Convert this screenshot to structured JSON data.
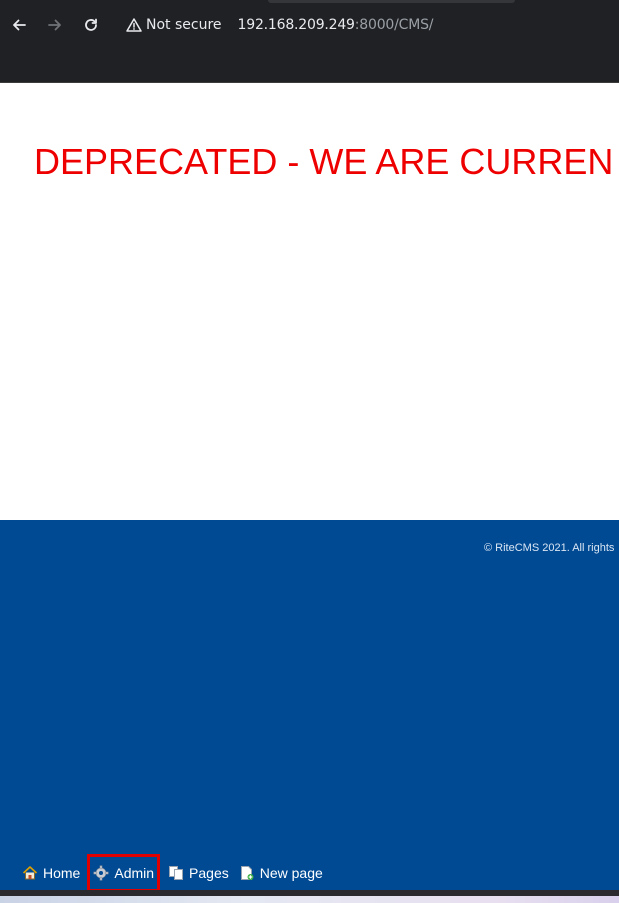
{
  "browser": {
    "security_label": "Not secure",
    "url_host": "192.168.209.249",
    "url_path": ":8000/CMS/"
  },
  "page": {
    "notice": "DEPRECATED - WE ARE CURREN",
    "notice_color": "#ee0000",
    "footer_bg": "#004a94",
    "copyright": "© RiteCMS 2021. All rights"
  },
  "adminbar": {
    "home_label": "Home",
    "admin_label": "Admin",
    "pages_label": "Pages",
    "new_page_label": "New page",
    "highlight_color": "#e00000"
  }
}
